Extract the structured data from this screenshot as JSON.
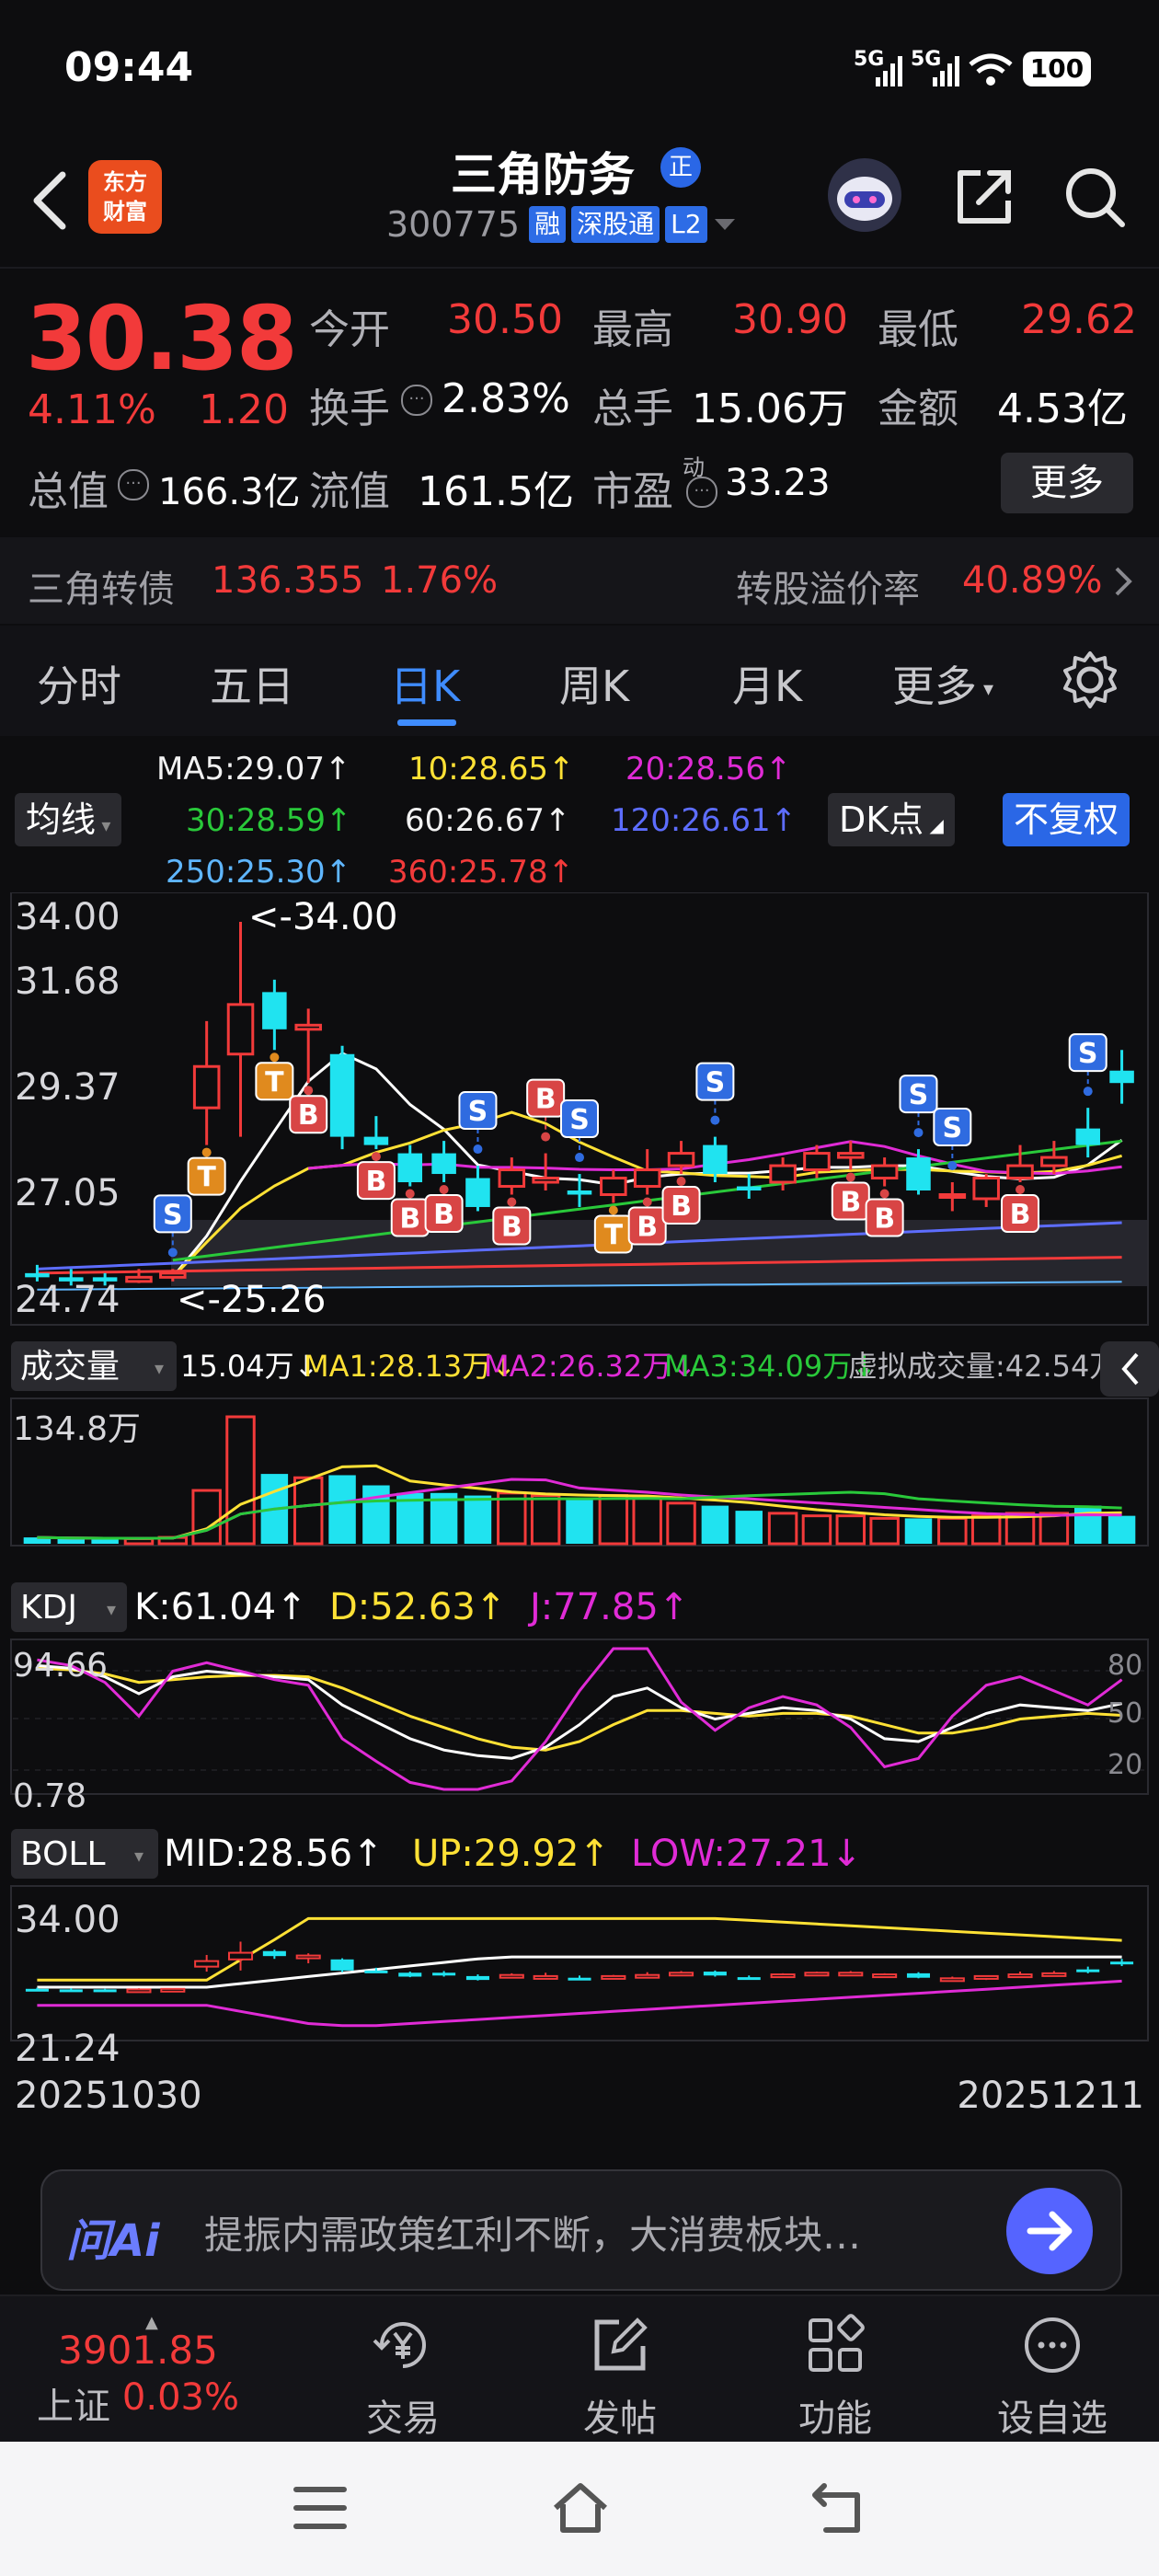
{
  "status_bar": {
    "time": "09:44",
    "signal1": "5G",
    "signal2": "5G",
    "battery": "100"
  },
  "header": {
    "logo_line1": "东方",
    "logo_line2": "财富",
    "stock_name": "三角防务",
    "name_badge": "正",
    "stock_code": "300775",
    "tags": [
      "融",
      "深股通",
      "L2"
    ]
  },
  "quote": {
    "price": "30.38",
    "change_pct": "4.11%",
    "change_val": "1.20",
    "open_label": "今开",
    "open": "30.50",
    "high_label": "最高",
    "high": "30.90",
    "low_label": "最低",
    "low": "29.62",
    "turnover_label": "换手",
    "turnover": "2.83%",
    "volume_label": "总手",
    "volume": "15.06万",
    "amount_label": "金额",
    "amount": "4.53亿",
    "mktcap_label": "总值",
    "mktcap": "166.3亿",
    "float_label": "流值",
    "float_val": "161.5亿",
    "pe_label": "市盈",
    "pe_sup": "动",
    "pe": "33.23",
    "more_label": "更多"
  },
  "bond": {
    "name": "三角转债",
    "price": "136.355",
    "pct": "1.76%",
    "premium_label": "转股溢价率",
    "premium": "40.89%"
  },
  "tabs": [
    "分时",
    "五日",
    "日K",
    "周K",
    "月K",
    "更多"
  ],
  "active_tab": 2,
  "ma_legend": {
    "pill": "均线",
    "ma5": "MA5:29.07↑",
    "ma10": "10:28.65↑",
    "ma20": "20:28.56↑",
    "ma30": "30:28.59↑",
    "ma60": "60:26.67↑",
    "ma120": "120:26.61↑",
    "ma250": "250:25.30↑",
    "ma360": "360:25.78↑",
    "dk_pill": "DK点",
    "fq_pill": "不复权"
  },
  "kline": {
    "y_labels": [
      "34.00",
      "31.68",
      "29.37",
      "27.05",
      "24.74"
    ],
    "max_label": "<-34.00",
    "min_label": "<-25.26"
  },
  "volume": {
    "pill": "成交量",
    "vol": "15.04万↓",
    "ma1": "MA1:28.13万↓",
    "ma2": "MA2:26.32万↓",
    "ma3": "MA3:34.09万↓",
    "virtual": "虚拟成交量:42.54万",
    "y_label": "134.8万"
  },
  "kdj": {
    "pill": "KDJ",
    "k": "K:61.04↑",
    "d": "D:52.63↑",
    "j": "J:77.85↑",
    "y_top": "94.66",
    "y_bottom": "0.78",
    "r80": "80",
    "r50": "50",
    "r20": "20"
  },
  "boll": {
    "pill": "BOLL",
    "mid": "MID:28.56↑",
    "up": "UP:29.92↑",
    "low": "LOW:27.21↓",
    "y_top": "34.00",
    "y_bottom": "21.24"
  },
  "dates": {
    "start": "20251030",
    "end": "20251211"
  },
  "ai": {
    "logo": "问Ai",
    "text": "提振内需政策红利不断，大消费板块…"
  },
  "bottom_nav": {
    "index_value": "3901.85",
    "index_name": "上证",
    "index_pct": "0.03%",
    "trade": "交易",
    "post": "发帖",
    "function": "功能",
    "watch": "设自选"
  },
  "chart_data": {
    "type": "candlestick",
    "x_range": [
      "20251030",
      "20251211"
    ],
    "ylim": [
      24.74,
      34.0
    ],
    "candles": [
      {
        "o": 25.4,
        "c": 25.5,
        "h": 25.7,
        "l": 25.3,
        "up": false
      },
      {
        "o": 25.3,
        "c": 25.4,
        "h": 25.6,
        "l": 25.2,
        "up": false
      },
      {
        "o": 25.4,
        "c": 25.3,
        "h": 25.5,
        "l": 25.2,
        "up": false
      },
      {
        "o": 25.3,
        "c": 25.4,
        "h": 25.6,
        "l": 25.26,
        "up": true
      },
      {
        "o": 25.5,
        "c": 25.4,
        "h": 25.6,
        "l": 25.3,
        "up": true
      },
      {
        "o": 29.5,
        "c": 30.5,
        "h": 31.6,
        "l": 28.6,
        "up": true
      },
      {
        "o": 30.8,
        "c": 32.0,
        "h": 34.0,
        "l": 28.8,
        "up": true
      },
      {
        "o": 32.3,
        "c": 31.4,
        "h": 32.6,
        "l": 30.9,
        "up": false
      },
      {
        "o": 31.5,
        "c": 31.4,
        "h": 31.9,
        "l": 30.1,
        "up": true
      },
      {
        "o": 30.8,
        "c": 28.8,
        "h": 31.0,
        "l": 28.5,
        "up": false
      },
      {
        "o": 28.8,
        "c": 28.6,
        "h": 29.3,
        "l": 28.5,
        "up": false
      },
      {
        "o": 28.4,
        "c": 27.7,
        "h": 28.6,
        "l": 27.6,
        "up": false
      },
      {
        "o": 27.9,
        "c": 28.4,
        "h": 28.7,
        "l": 27.7,
        "up": false
      },
      {
        "o": 27.8,
        "c": 27.1,
        "h": 28.1,
        "l": 27.0,
        "up": false
      },
      {
        "o": 27.6,
        "c": 28.0,
        "h": 28.3,
        "l": 27.4,
        "up": true
      },
      {
        "o": 27.7,
        "c": 27.8,
        "h": 28.4,
        "l": 27.5,
        "up": true
      },
      {
        "o": 27.4,
        "c": 27.5,
        "h": 27.9,
        "l": 27.1,
        "up": false
      },
      {
        "o": 27.4,
        "c": 27.8,
        "h": 28.0,
        "l": 27.2,
        "up": true
      },
      {
        "o": 27.6,
        "c": 28.0,
        "h": 28.5,
        "l": 27.4,
        "up": true
      },
      {
        "o": 28.1,
        "c": 28.4,
        "h": 28.7,
        "l": 27.9,
        "up": true
      },
      {
        "o": 28.6,
        "c": 27.9,
        "h": 28.8,
        "l": 27.7,
        "up": false
      },
      {
        "o": 27.6,
        "c": 27.5,
        "h": 27.9,
        "l": 27.3,
        "up": false
      },
      {
        "o": 27.7,
        "c": 28.1,
        "h": 28.3,
        "l": 27.5,
        "up": true
      },
      {
        "o": 28.0,
        "c": 28.4,
        "h": 28.6,
        "l": 27.8,
        "up": true
      },
      {
        "o": 28.3,
        "c": 28.4,
        "h": 28.7,
        "l": 28.0,
        "up": true
      },
      {
        "o": 27.8,
        "c": 28.1,
        "h": 28.3,
        "l": 27.6,
        "up": true
      },
      {
        "o": 28.3,
        "c": 27.5,
        "h": 28.5,
        "l": 27.4,
        "up": false
      },
      {
        "o": 27.4,
        "c": 27.4,
        "h": 27.7,
        "l": 27.0,
        "up": true
      },
      {
        "o": 27.3,
        "c": 27.8,
        "h": 27.9,
        "l": 27.1,
        "up": true
      },
      {
        "o": 27.8,
        "c": 28.1,
        "h": 28.6,
        "l": 27.7,
        "up": true
      },
      {
        "o": 28.1,
        "c": 28.3,
        "h": 28.7,
        "l": 27.9,
        "up": true
      },
      {
        "o": 28.6,
        "c": 29.0,
        "h": 29.5,
        "l": 28.3,
        "up": false
      },
      {
        "o": 30.1,
        "c": 30.4,
        "h": 30.9,
        "l": 29.6,
        "up": false
      }
    ],
    "volume_max_label": "134.8万"
  }
}
